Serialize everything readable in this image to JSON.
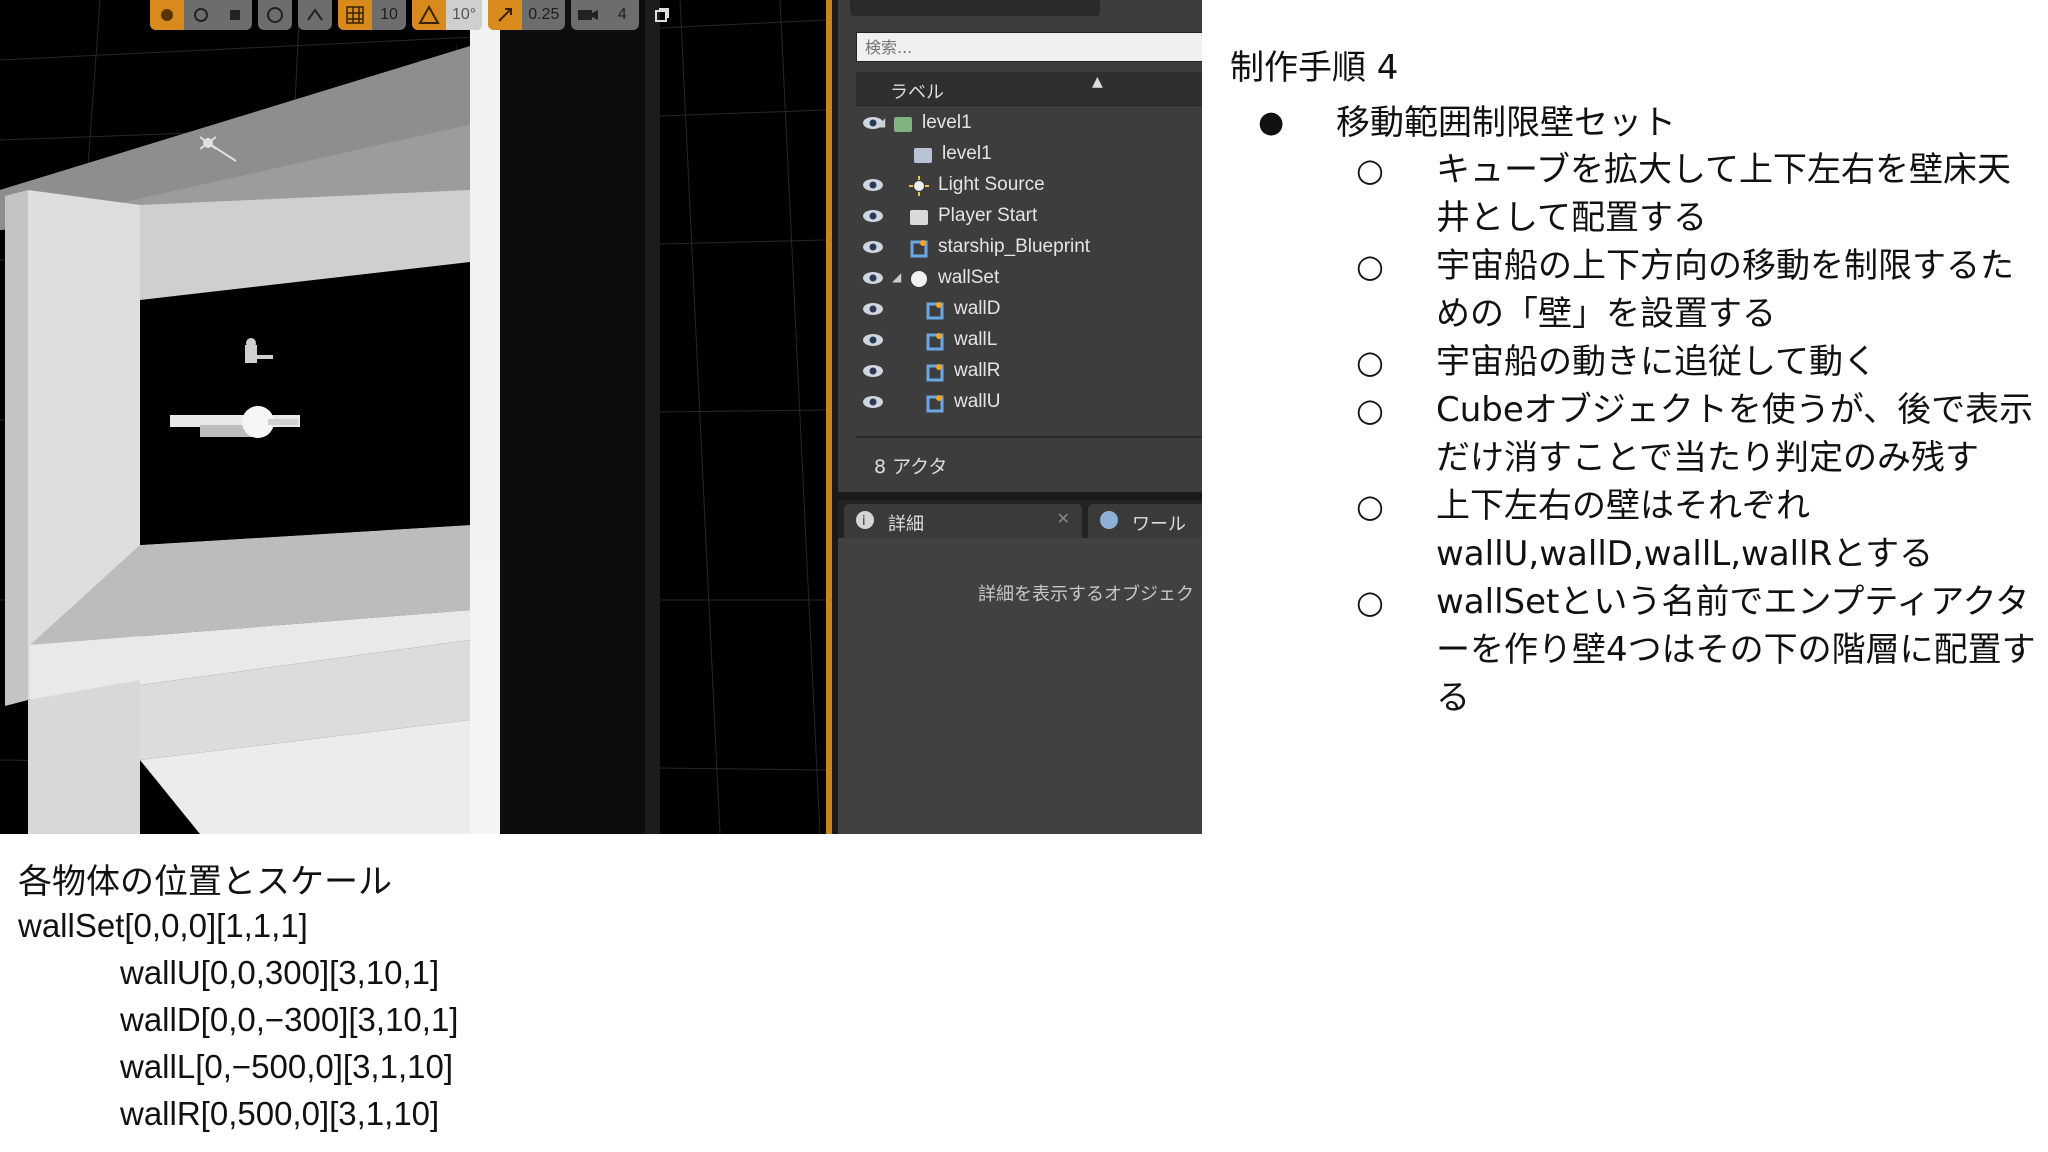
{
  "toolbar": {
    "grid_snap_value": "10",
    "rotation_snap_value": "10°",
    "scale_snap_value": "0.25",
    "camera_speed_value": "4"
  },
  "outliner": {
    "search_placeholder": "検索...",
    "column_label": "ラベル",
    "items": [
      {
        "label": "level1",
        "icon": "world-icon"
      },
      {
        "label": "level1",
        "icon": "level-icon"
      },
      {
        "label": "Light Source",
        "icon": "light-icon"
      },
      {
        "label": "Player Start",
        "icon": "player-start-icon"
      },
      {
        "label": "starship_Blueprint",
        "icon": "blueprint-icon"
      },
      {
        "label": "wallSet",
        "icon": "empty-actor-icon"
      },
      {
        "label": "wallD",
        "icon": "blueprint-icon"
      },
      {
        "label": "wallL",
        "icon": "blueprint-icon"
      },
      {
        "label": "wallR",
        "icon": "blueprint-icon"
      },
      {
        "label": "wallU",
        "icon": "blueprint-icon"
      }
    ],
    "actor_count": "8 アクタ"
  },
  "details": {
    "tab_details": "詳細",
    "tab_world": "ワール",
    "empty_message": "詳細を表示するオブジェク"
  },
  "steps": {
    "title": "制作手順 4",
    "heading": "移動範囲制限壁セット",
    "items": [
      "キューブを拡大して上下左右を壁床天井として配置する",
      "宇宙船の上下方向の移動を制限するための「壁」を設置する",
      "宇宙船の動きに追従して動く",
      "Cubeオブジェクトを使うが、後で表示だけ消すことで当たり判定のみ残す",
      "上下左右の壁はそれぞれ wallU,wallD,wallL,wallRとする",
      "wallSetという名前でエンプティアクターを作り壁4つはその下の階層に配置する"
    ]
  },
  "transforms": {
    "title": "各物体の位置とスケール",
    "lines": [
      "wallSet[0,0,0][1,1,1]",
      "wallU[0,0,300][3,10,1]",
      "wallD[0,0,−300][3,10,1]",
      "wallL[0,−500,0][3,1,10]",
      "wallR[0,500,0][3,1,10]"
    ]
  },
  "colors": {
    "viewport_bg": "#000000",
    "toolbar_active": "#d88a1c",
    "outliner_bg": "#3d3d3d",
    "panel_border": "#c5861f"
  }
}
